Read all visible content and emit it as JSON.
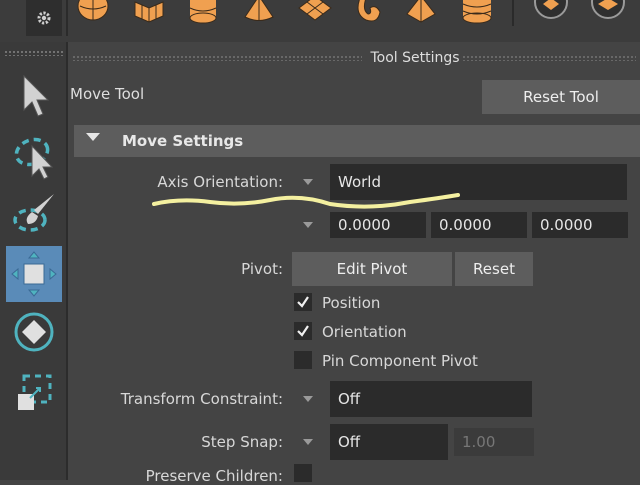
{
  "shelf": {
    "icons": [
      "settings-gear-icon",
      "sphere-icon",
      "cube-icon",
      "cylinder-icon",
      "cone-icon",
      "plane-icon",
      "torus-icon",
      "pyramid-icon",
      "pipe-icon",
      "sphere-cap-icon",
      "subdivide-icon"
    ]
  },
  "toolbox": {
    "tools": [
      {
        "name": "select-tool-icon",
        "active": false
      },
      {
        "name": "lasso-tool-icon",
        "active": false
      },
      {
        "name": "paint-select-tool-icon",
        "active": false
      },
      {
        "name": "move-tool-icon",
        "active": true
      },
      {
        "name": "rotate-tool-icon",
        "active": false
      },
      {
        "name": "scale-tool-icon",
        "active": false
      }
    ]
  },
  "panel": {
    "title": "Tool Settings",
    "tool_name": "Move Tool",
    "reset_tool": "Reset Tool",
    "section_title": "Move Settings",
    "axis_orientation": {
      "label": "Axis Orientation:",
      "value": "World"
    },
    "coords": [
      "0.0000",
      "0.0000",
      "0.0000"
    ],
    "pivot": {
      "label": "Pivot:",
      "edit_pivot": "Edit Pivot",
      "reset": "Reset"
    },
    "checkboxes": [
      {
        "label": "Position",
        "checked": true
      },
      {
        "label": "Orientation",
        "checked": true
      },
      {
        "label": "Pin Component Pivot",
        "checked": false
      }
    ],
    "transform_constraint": {
      "label": "Transform Constraint:",
      "value": "Off"
    },
    "step_snap": {
      "label": "Step Snap:",
      "value": "Off",
      "amount": "1.00"
    },
    "preserve_children": {
      "label": "Preserve Children:",
      "checked": false
    }
  },
  "colors": {
    "accent": "#5a8bb8",
    "highlight": "#f4f0a0",
    "shelf_icon": "#f0a050"
  }
}
